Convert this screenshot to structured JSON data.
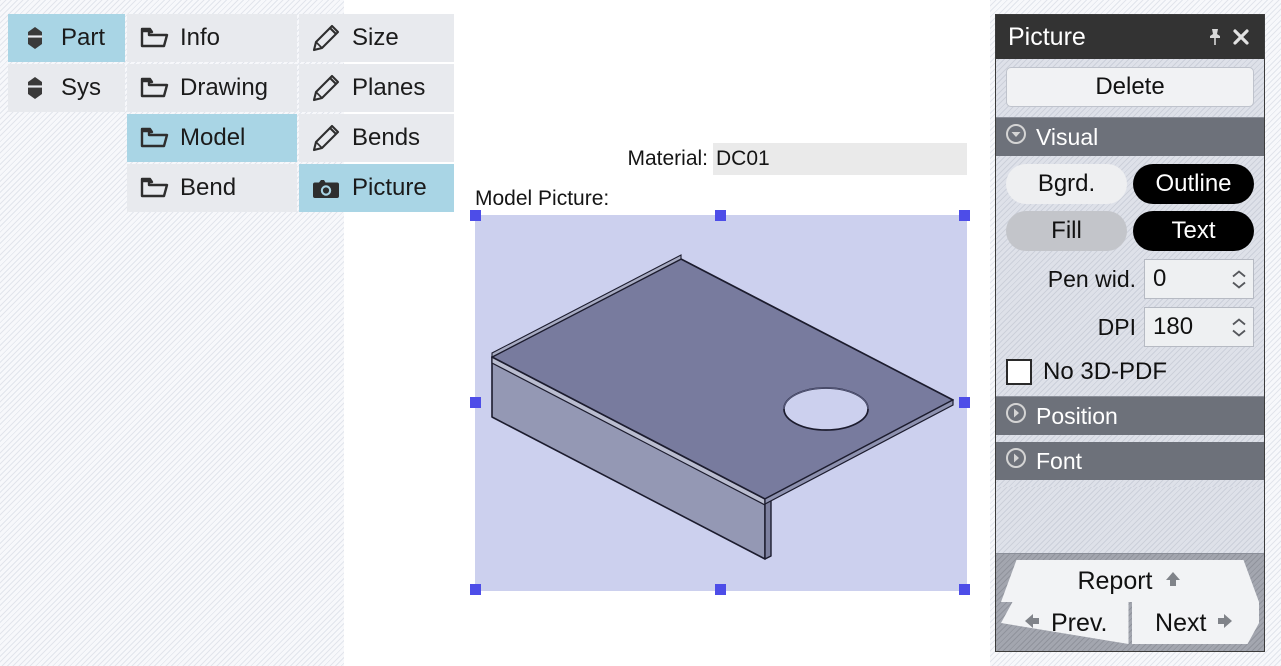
{
  "menu": {
    "columns": [
      {
        "name": "scope",
        "items": [
          {
            "label": "Part",
            "icon": "part-icon",
            "selected": true
          },
          {
            "label": "Sys",
            "icon": "part-icon",
            "selected": false
          }
        ]
      },
      {
        "name": "category",
        "items": [
          {
            "label": "Info",
            "icon": "folder-icon",
            "selected": false
          },
          {
            "label": "Drawing",
            "icon": "folder-icon",
            "selected": false
          },
          {
            "label": "Model",
            "icon": "folder-icon",
            "selected": true
          },
          {
            "label": "Bend",
            "icon": "folder-icon",
            "selected": false
          }
        ]
      },
      {
        "name": "subcategory",
        "items": [
          {
            "label": "Size",
            "icon": "pencil-icon",
            "selected": false
          },
          {
            "label": "Planes",
            "icon": "pencil-icon",
            "selected": false
          },
          {
            "label": "Bends",
            "icon": "pencil-icon",
            "selected": false
          },
          {
            "label": "Picture",
            "icon": "camera-icon",
            "selected": true
          }
        ]
      }
    ]
  },
  "document": {
    "material_label": "Material:",
    "material_value": "DC01",
    "picture_label": "Model Picture:",
    "picture_alt": "isometric sheet-metal bent plate with circular hole"
  },
  "panel": {
    "title": "Picture",
    "pin_icon": "pin-icon",
    "close_icon": "close-icon",
    "delete_label": "Delete",
    "visual": {
      "header": "Visual",
      "collapse_icon": "chevron-down-circle-icon",
      "bgrd_label": "Bgrd.",
      "outline_label": "Outline",
      "fill_label": "Fill",
      "text_label": "Text",
      "pen_width_label": "Pen wid.",
      "pen_width_value": "0",
      "dpi_label": "DPI",
      "dpi_value": "180",
      "no3dpdf_label": "No 3D-PDF",
      "no3dpdf_checked": false
    },
    "position": {
      "header": "Position",
      "collapse_icon": "chevron-right-circle-icon"
    },
    "font": {
      "header": "Font",
      "collapse_icon": "chevron-right-circle-icon"
    },
    "nav": {
      "report_label": "Report",
      "report_icon": "arrow-up-icon",
      "prev_label": "Prev.",
      "prev_icon": "arrow-left-icon",
      "next_label": "Next",
      "next_icon": "arrow-right-icon"
    }
  },
  "colors": {
    "menu_selected": "#a9d5e5",
    "menu_normal": "#e8eaee",
    "selection_bg": "#ccd0ee",
    "handle": "#4d4de8",
    "panel_title_bg": "#333333",
    "section_hdr_bg": "#6d717a",
    "model_top_face": "#787b9e",
    "model_side_face": "#9498b4"
  }
}
